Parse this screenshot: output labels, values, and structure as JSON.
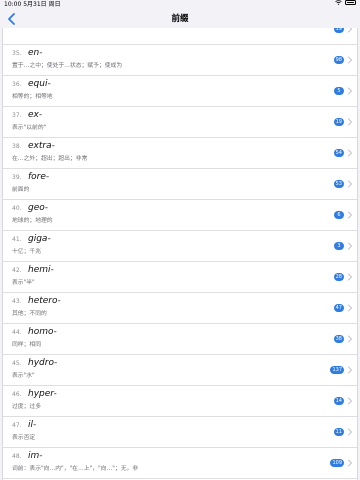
{
  "status_bar": {
    "time": "10:00",
    "date": "5月31日 周日"
  },
  "nav": {
    "title": "前缀"
  },
  "colors": {
    "accent": "#2f7de1",
    "badge": "#2f7de1"
  },
  "icons": {
    "back": "chevron-left-icon",
    "wifi": "wifi-icon",
    "battery": "battery-icon",
    "row": "chevron-right-icon"
  },
  "items": [
    {
      "num": "34.",
      "word": "em-",
      "meaning": "",
      "count": "19"
    },
    {
      "num": "35.",
      "word": "en-",
      "meaning": "置于…之中；使处于…状态；赋予；使成为",
      "count": "98"
    },
    {
      "num": "36.",
      "word": "equi-",
      "meaning": "相等的；相等地",
      "count": "5"
    },
    {
      "num": "37.",
      "word": "ex-",
      "meaning": "表示\"以前的\"",
      "count": "19"
    },
    {
      "num": "38.",
      "word": "extra-",
      "meaning": "在…之外；超出；超出；非常",
      "count": "54"
    },
    {
      "num": "39.",
      "word": "fore-",
      "meaning": "前面的",
      "count": "53"
    },
    {
      "num": "40.",
      "word": "geo-",
      "meaning": "地球的；地理的",
      "count": "6"
    },
    {
      "num": "41.",
      "word": "giga-",
      "meaning": "十亿；千兆",
      "count": "3"
    },
    {
      "num": "42.",
      "word": "hemi-",
      "meaning": "表示\"半\"",
      "count": "28"
    },
    {
      "num": "43.",
      "word": "hetero-",
      "meaning": "其他；不同的",
      "count": "47"
    },
    {
      "num": "44.",
      "word": "homo-",
      "meaning": "同样；相同",
      "count": "38"
    },
    {
      "num": "45.",
      "word": "hydro-",
      "meaning": "表示\"水\"",
      "count": "137"
    },
    {
      "num": "46.",
      "word": "hyper-",
      "meaning": "过度；过多",
      "count": "14"
    },
    {
      "num": "47.",
      "word": "il-",
      "meaning": "表示否定",
      "count": "11"
    },
    {
      "num": "48.",
      "word": "im-",
      "meaning": "词前：表示\"向…内\"，\"在…上\"，\"向…\"；无，非",
      "count": "109"
    }
  ]
}
